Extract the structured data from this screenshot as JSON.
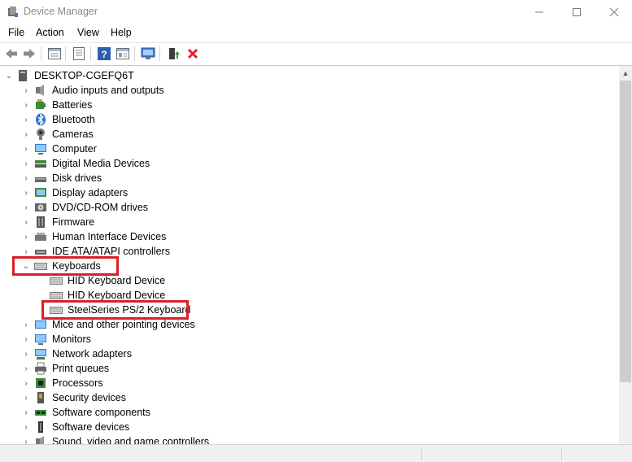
{
  "window": {
    "title": "Device Manager"
  },
  "menu": {
    "items": [
      "File",
      "Action",
      "View",
      "Help"
    ]
  },
  "toolbar": {
    "buttons": [
      "back-arrow-icon",
      "forward-arrow-icon",
      "properties-list-icon",
      "properties-sheet-icon",
      "help-icon",
      "action-view-icon",
      "scan-hardware-icon",
      "update-driver-icon",
      "uninstall-device-icon"
    ]
  },
  "tree": {
    "root": "DESKTOP-CGEFQ6T",
    "categories": [
      "Audio inputs and outputs",
      "Batteries",
      "Bluetooth",
      "Cameras",
      "Computer",
      "Digital Media Devices",
      "Disk drives",
      "Display adapters",
      "DVD/CD-ROM drives",
      "Firmware",
      "Human Interface Devices",
      "IDE ATA/ATAPI controllers",
      "Keyboards",
      "Mice and other pointing devices",
      "Monitors",
      "Network adapters",
      "Print queues",
      "Processors",
      "Security devices",
      "Software components",
      "Software devices",
      "Sound, video and game controllers"
    ],
    "keyboards_children": [
      "HID Keyboard Device",
      "HID Keyboard Device",
      "SteelSeries PS/2 Keyboard"
    ]
  },
  "colors": {
    "highlight": "#d9202a",
    "uninstall": "#e0242a"
  }
}
